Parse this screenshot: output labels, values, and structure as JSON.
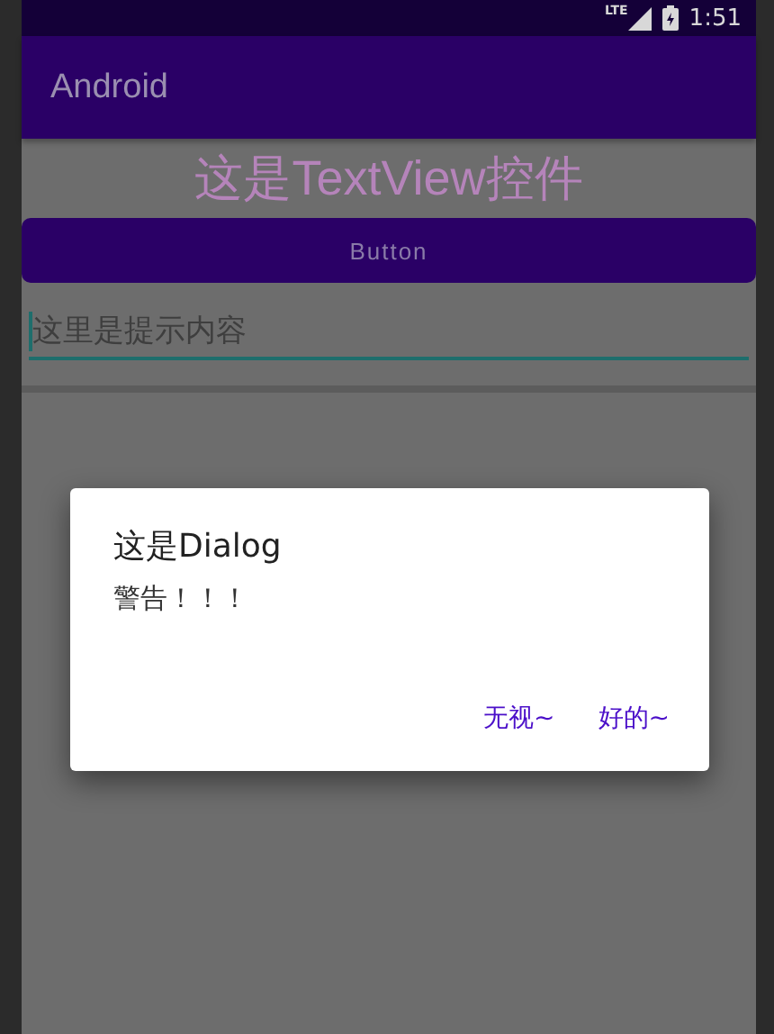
{
  "status_bar": {
    "network": "LTE",
    "time": "1:51"
  },
  "app_bar": {
    "title": "Android"
  },
  "text_view": "这是TextView控件",
  "button": "Button",
  "edit_text": {
    "placeholder": "这里是提示内容",
    "focused": true
  },
  "dialog": {
    "title": "这是Dialog",
    "message": "警告！！！",
    "buttons": [
      "无视~",
      "好的~"
    ]
  }
}
